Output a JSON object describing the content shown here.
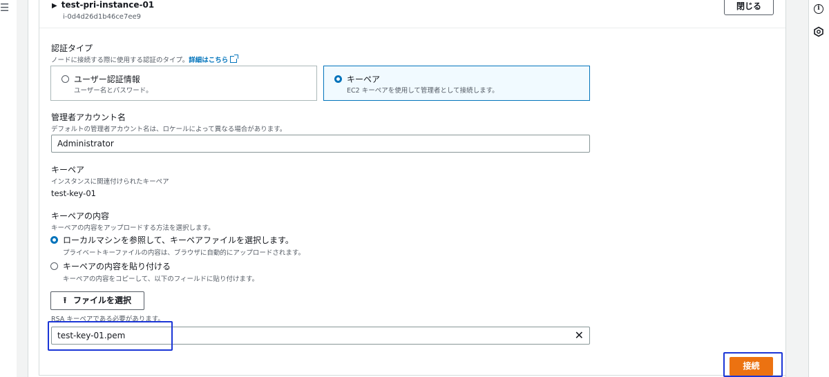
{
  "instance": {
    "name": "test-pri-instance-01",
    "id": "i-0d4d26d1b46ce7ee9",
    "close_label": "閉じる"
  },
  "auth_type": {
    "label": "認証タイプ",
    "description": "ノードに接続する際に使用する認証のタイプ。",
    "link_label": "詳細はこちら",
    "options": [
      {
        "title": "ユーザー認証情報",
        "description": "ユーザー名とパスワード。",
        "selected": false
      },
      {
        "title": "キーペア",
        "description": "EC2 キーペアを使用して管理者として接続します。",
        "selected": true
      }
    ]
  },
  "admin_account": {
    "label": "管理者アカウント名",
    "description": "デフォルトの管理者アカウント名は、ロケールによって異なる場合があります。",
    "value": "Administrator"
  },
  "key_pair": {
    "label": "キーペア",
    "description": "インスタンスに関連付けられたキーペア",
    "value": "test-key-01"
  },
  "key_content": {
    "label": "キーペアの内容",
    "description": "キーペアの内容をアップロードする方法を選択します。",
    "options": [
      {
        "title": "ローカルマシンを参照して、キーペアファイルを選択します。",
        "description": "プライベートキーファイルの内容は、ブラウザに自動的にアップロードされます。",
        "selected": true
      },
      {
        "title": "キーペアの内容を貼り付ける",
        "description": "キーペアの内容をコピーして、以下のフィールドに貼り付けます。",
        "selected": false
      }
    ],
    "file_button_label": "ファイルを選択",
    "file_hint": "RSA キーペアである必要があります。",
    "file_value": "test-key-01.pem"
  },
  "footer": {
    "connect_label": "接続"
  },
  "colors": {
    "primary_button": "#ec7211",
    "selected_border": "#0073bb",
    "highlight_annotation": "#1a35d6"
  }
}
